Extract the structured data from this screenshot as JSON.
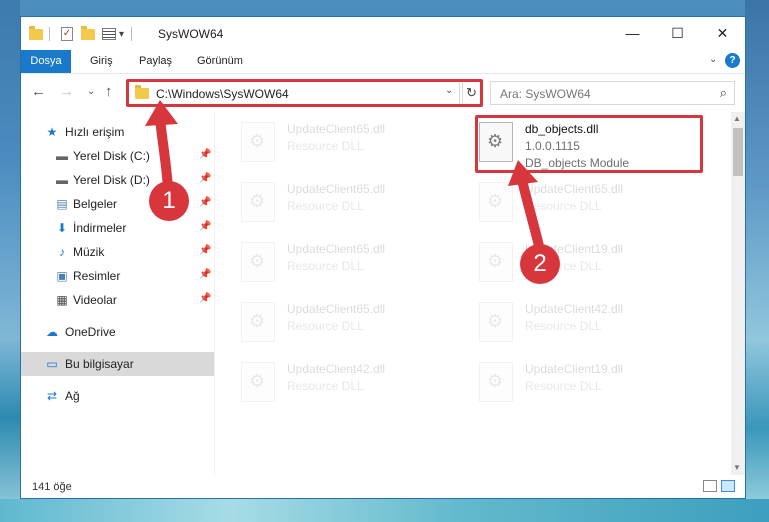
{
  "window": {
    "title": "SysWOW64",
    "controls": {
      "minimize": "—",
      "maximize": "☐",
      "close": "✕"
    }
  },
  "ribbon": {
    "tabs": [
      "Dosya",
      "Giriş",
      "Paylaş",
      "Görünüm"
    ],
    "help": "?",
    "expand": "⌄"
  },
  "navigation": {
    "back": "←",
    "forward": "→",
    "recent": "⌄",
    "up": "↑",
    "address": "C:\\Windows\\SysWOW64",
    "refresh": "↻",
    "search_placeholder": "Ara: SysWOW64",
    "search_icon": "⌕"
  },
  "sidebar": {
    "items": [
      {
        "label": "Hızlı erişim",
        "icon": "star-icon",
        "glyph": "★",
        "pinned": false
      },
      {
        "label": "Yerel Disk (C:)",
        "icon": "drive-icon",
        "glyph": "▬",
        "pinned": true
      },
      {
        "label": "Yerel Disk (D:)",
        "icon": "drive-icon",
        "glyph": "▬",
        "pinned": true
      },
      {
        "label": "Belgeler",
        "icon": "documents-icon",
        "glyph": "▤",
        "pinned": true
      },
      {
        "label": "İndirmeler",
        "icon": "download-icon",
        "glyph": "⬇",
        "pinned": true
      },
      {
        "label": "Müzik",
        "icon": "music-icon",
        "glyph": "♪",
        "pinned": true
      },
      {
        "label": "Resimler",
        "icon": "pictures-icon",
        "glyph": "▣",
        "pinned": true
      },
      {
        "label": "Videolar",
        "icon": "videos-icon",
        "glyph": "▦",
        "pinned": true
      },
      {
        "label": "OneDrive",
        "icon": "cloud-icon",
        "glyph": "☁",
        "pinned": false
      },
      {
        "label": "Bu bilgisayar",
        "icon": "computer-icon",
        "glyph": "▭",
        "pinned": false
      },
      {
        "label": "Ağ",
        "icon": "network-icon",
        "glyph": "⇄",
        "pinned": false
      }
    ],
    "pin_glyph": "📌"
  },
  "files": {
    "highlighted": {
      "name": "db_objects.dll",
      "version": "1.0.0.1115",
      "description": "DB_objects Module"
    },
    "left_column": [
      {
        "name": "UpdateClient65.dll",
        "description": "Resource DLL"
      },
      {
        "name": "UpdateClient65.dll",
        "description": "Resource DLL"
      },
      {
        "name": "UpdateClient65.dll",
        "description": "Resource DLL"
      },
      {
        "name": "UpdateClient65.dll",
        "description": "Resource DLL"
      },
      {
        "name": "UpdateClient42.dll",
        "description": "Resource DLL"
      }
    ],
    "right_column": [
      {
        "name": "UpdateClient65.dll",
        "description": "Resource DLL"
      },
      {
        "name": "UpdateClient19.dll",
        "description": "Resource DLL"
      },
      {
        "name": "UpdateClient42.dll",
        "description": "Resource DLL"
      },
      {
        "name": "UpdateClient19.dll",
        "description": "Resource DLL"
      }
    ]
  },
  "status": {
    "item_count": "141 öğe"
  },
  "callouts": {
    "step1": "1",
    "step2": "2"
  },
  "colors": {
    "accent": "#1979ca",
    "highlight": "#d6363c",
    "selected": "#cce8ff"
  }
}
